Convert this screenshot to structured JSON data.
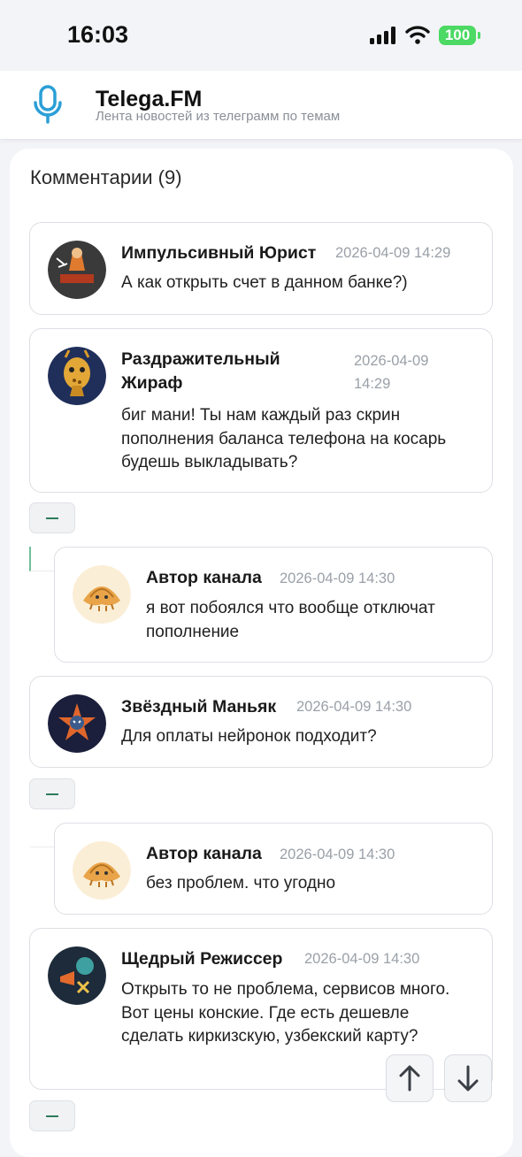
{
  "status": {
    "time": "16:03",
    "battery": "100"
  },
  "app": {
    "title": "Telega.FM",
    "subtitle": "Лента новостей из телеграмм по темам"
  },
  "comments_header": "Комментарии (9)",
  "comments": [
    {
      "author": "Импульсивный Юрист",
      "date": "2026-04-09 14:29",
      "text": "А как открыть счет в данном банке?)"
    },
    {
      "author": "Раздражительный Жираф",
      "date": "2026-04-09 14:29",
      "text": "биг мани! Ты нам каждый раз скрин пополнения баланса телефона на косарь будешь выкладывать?"
    },
    {
      "author": "Автор канала",
      "date": "2026-04-09 14:30",
      "text": "я вот побоялся что вообще отключат пополнение"
    },
    {
      "author": "Звёздный Маньяк",
      "date": "2026-04-09 14:30",
      "text": "Для оплаты нейронок подходит?"
    },
    {
      "author": "Автор канала",
      "date": "2026-04-09 14:30",
      "text": "без проблем. что угодно"
    },
    {
      "author": "Щедрый Режиссер",
      "date": "2026-04-09 14:30",
      "text": "Открыть то не проблема, сервисов много. Вот цены конские. Где есть дешевле сделать киркизскую, узбекский карту?"
    }
  ],
  "colors": {
    "accent": "#2e7d5b",
    "mic": "#2a9fd6",
    "battery": "#4cd964"
  }
}
